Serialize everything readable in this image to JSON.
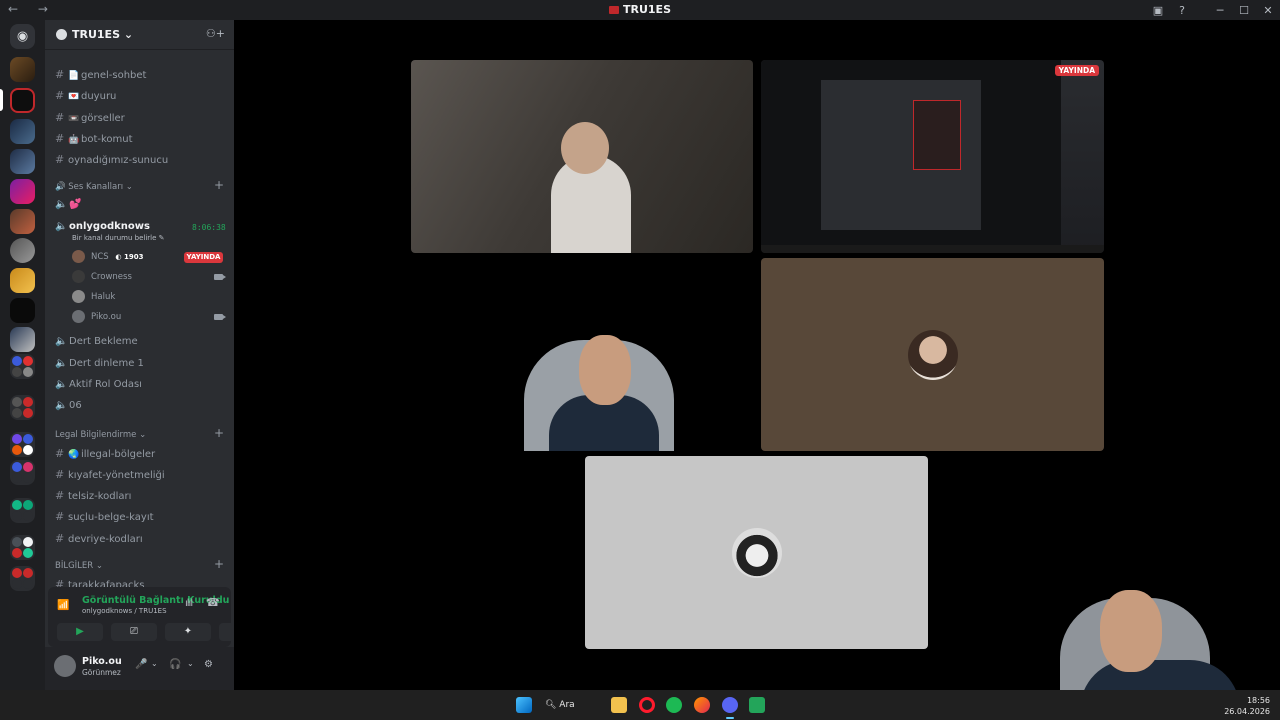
{
  "window": {
    "title": "TRU1ES",
    "nav_arrows": "← →"
  },
  "guild": {
    "name": "TRU1ES ⌄"
  },
  "channels": [
    {
      "type": "text",
      "emoji": "📄",
      "name": "genel-sohbet"
    },
    {
      "type": "text",
      "emoji": "💌",
      "name": "duyuru"
    },
    {
      "type": "text",
      "emoji": "📼",
      "name": "görseller"
    },
    {
      "type": "text",
      "emoji": "🤖",
      "name": "bot-komut"
    },
    {
      "type": "text",
      "emoji": "",
      "name": "oynadığımız-sunucu"
    }
  ],
  "voice_category": {
    "label": "🔊 Ses Kanalları ⌄",
    "first_channel_emoji": "💕"
  },
  "active_voice": {
    "name": "onlygodknows",
    "timer": "8:06:38",
    "status_hint": "Bir kanal durumu belirle ✎",
    "participants": [
      {
        "name": "NCS",
        "badge": "1903",
        "live": true
      },
      {
        "name": "Crowness",
        "camera": true
      },
      {
        "name": "Haluk"
      },
      {
        "name": "Piko.ou",
        "camera": true
      }
    ],
    "live_label": "YAYINDA"
  },
  "voice_channels": [
    "Dert Bekleme",
    "Dert dinleme 1",
    "Aktif Rol Odası",
    "06"
  ],
  "legal_category": {
    "label": "Legal Bilgilendirme ⌄",
    "channels": [
      {
        "emoji": "🌏",
        "name": "illegal-bölgeler"
      },
      {
        "emoji": "",
        "name": "kıyafet-yönetmeliği"
      },
      {
        "emoji": "",
        "name": "telsiz-kodları"
      },
      {
        "emoji": "",
        "name": "suçlu-belge-kayıt"
      },
      {
        "emoji": "",
        "name": "devriye-kodları"
      }
    ]
  },
  "info_category": {
    "label": "BİLGİLER ⌄",
    "channels": [
      {
        "name": "tarakkafapacks"
      }
    ]
  },
  "voice_panel": {
    "title": "Görüntülü Bağlantı Kuruldu",
    "subtitle": "onlygodknows / TRU1ES"
  },
  "user_panel": {
    "name": "Piko.ou",
    "status": "Görünmez"
  },
  "stage": {
    "live_badge": "YAYINDA"
  },
  "taskbar": {
    "search_label": "Ara",
    "time": "18:56",
    "date": "26.04.2026"
  },
  "colors": {
    "accent_green": "#23a55a",
    "live_red": "#da373c",
    "sidebar_bg": "#2b2d31",
    "rail_bg": "#1e1f22",
    "tile_brown": "#584839",
    "tile_grey": "#c6c6c6"
  }
}
